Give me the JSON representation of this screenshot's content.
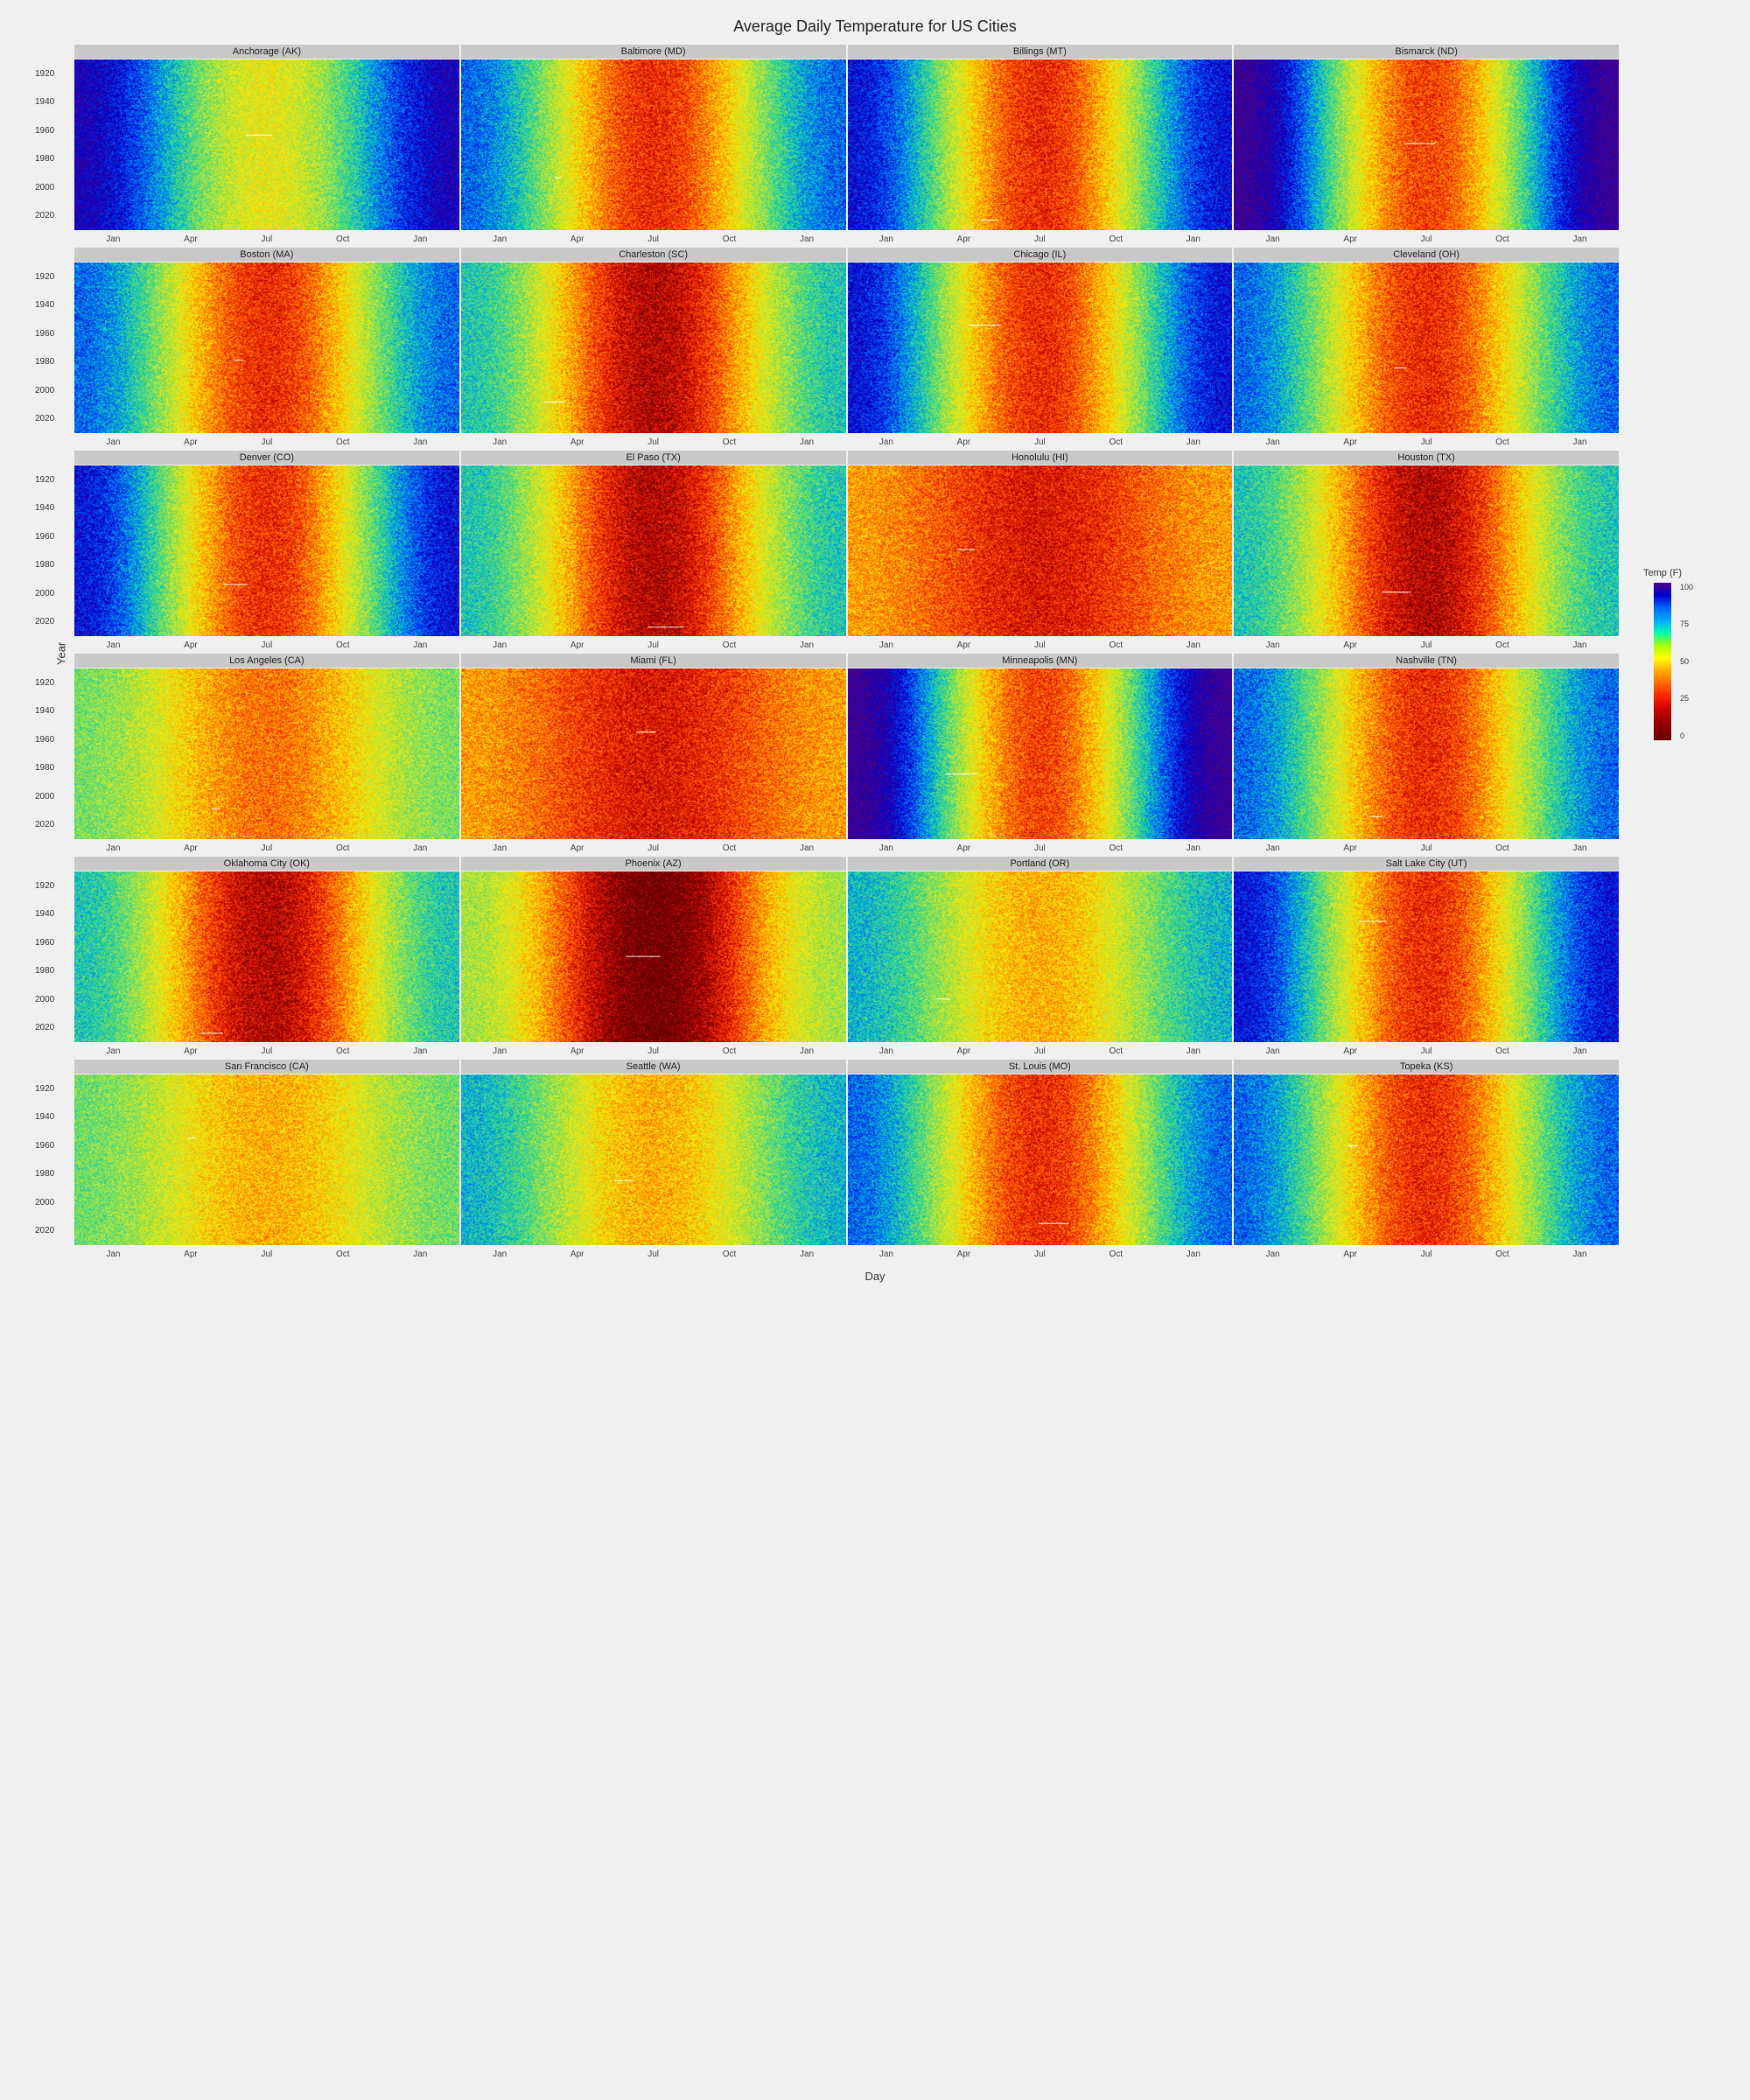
{
  "title": "Average Daily Temperature for US Cities",
  "yAxisLabel": "Year",
  "xAxisLabel": "Day",
  "legend": {
    "title": "Temp (F)",
    "labels": [
      "100",
      "75",
      "50",
      "25",
      "0"
    ]
  },
  "xAxisMonths": [
    "Jan",
    "Apr",
    "Jul",
    "Oct",
    "Jan"
  ],
  "yearLabels": [
    "1920",
    "1940",
    "1960",
    "1980",
    "2000",
    "2020"
  ],
  "rows": [
    {
      "cities": [
        {
          "name": "Anchorage (AK)",
          "colorProfile": "cold"
        },
        {
          "name": "Baltimore (MD)",
          "colorProfile": "warm_mid"
        },
        {
          "name": "Billings (MT)",
          "colorProfile": "mid_seasonal"
        },
        {
          "name": "Bismarck (ND)",
          "colorProfile": "cold_seasonal"
        }
      ]
    },
    {
      "cities": [
        {
          "name": "Boston (MA)",
          "colorProfile": "warm_mid"
        },
        {
          "name": "Charleston (SC)",
          "colorProfile": "warm_hot"
        },
        {
          "name": "Chicago (IL)",
          "colorProfile": "mid_seasonal"
        },
        {
          "name": "Cleveland (OH)",
          "colorProfile": "warm_mid"
        }
      ]
    },
    {
      "cities": [
        {
          "name": "Denver (CO)",
          "colorProfile": "mid_seasonal"
        },
        {
          "name": "El Paso (TX)",
          "colorProfile": "warm_hot"
        },
        {
          "name": "Honolulu (HI)",
          "colorProfile": "hot_constant"
        },
        {
          "name": "Houston (TX)",
          "colorProfile": "warm_hot"
        }
      ]
    },
    {
      "cities": [
        {
          "name": "Los Angeles (CA)",
          "colorProfile": "warm_mild"
        },
        {
          "name": "Miami (FL)",
          "colorProfile": "hot_constant"
        },
        {
          "name": "Minneapolis (MN)",
          "colorProfile": "cold_seasonal"
        },
        {
          "name": "Nashville (TN)",
          "colorProfile": "warm_mid"
        }
      ]
    },
    {
      "cities": [
        {
          "name": "Oklahoma City (OK)",
          "colorProfile": "warm_hot"
        },
        {
          "name": "Phoenix (AZ)",
          "colorProfile": "hot_extreme"
        },
        {
          "name": "Portland (OR)",
          "colorProfile": "mild_seasonal"
        },
        {
          "name": "Salt Lake City (UT)",
          "colorProfile": "mid_seasonal"
        }
      ]
    },
    {
      "cities": [
        {
          "name": "San Francisco (CA)",
          "colorProfile": "mild_constant"
        },
        {
          "name": "Seattle (WA)",
          "colorProfile": "mild_seasonal"
        },
        {
          "name": "St. Louis (MO)",
          "colorProfile": "warm_mid"
        },
        {
          "name": "Topeka (KS)",
          "colorProfile": "warm_mid"
        }
      ]
    }
  ]
}
